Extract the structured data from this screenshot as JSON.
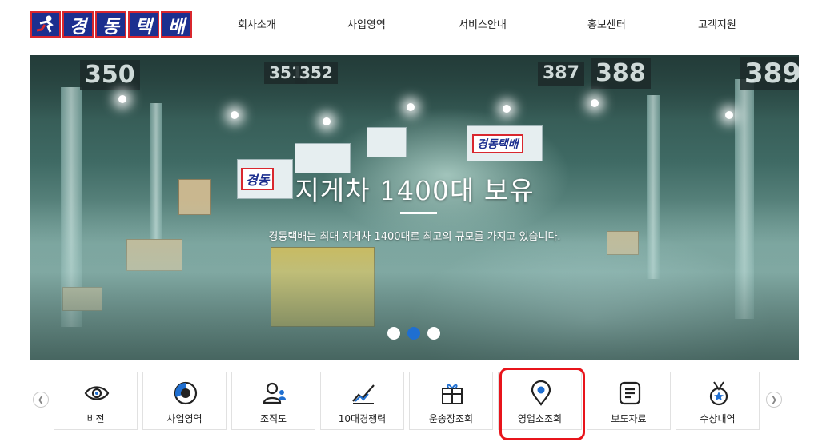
{
  "header": {
    "logo_text": [
      "경",
      "동",
      "택",
      "배"
    ],
    "nav": [
      "회사소개",
      "사업영역",
      "서비스안내",
      "홍보센터",
      "고객지원"
    ]
  },
  "hero": {
    "dock_signs": [
      "350",
      "351",
      "352",
      "387",
      "388",
      "389"
    ],
    "truck_logos": [
      "경동택배",
      "경동"
    ],
    "title": "지게차 1400대 보유",
    "subtitle": "경동택배는 최대 지게차 1400대로 최고의 규모를 가지고 있습니다.",
    "slides": 3,
    "active_slide": 2
  },
  "quick_menu": {
    "prev_icon": "chevron-left-icon",
    "next_icon": "chevron-right-icon",
    "items": [
      {
        "label": "비전",
        "icon": "eye-icon"
      },
      {
        "label": "사업영역",
        "icon": "pie-chart-icon"
      },
      {
        "label": "조직도",
        "icon": "people-icon"
      },
      {
        "label": "10대경쟁력",
        "icon": "trend-chart-icon"
      },
      {
        "label": "운송장조회",
        "icon": "gift-box-icon"
      },
      {
        "label": "영업소조회",
        "icon": "map-pin-icon"
      },
      {
        "label": "보도자료",
        "icon": "document-lines-icon"
      },
      {
        "label": "수상내역",
        "icon": "medal-icon"
      }
    ],
    "highlighted_item": "영업소조회"
  },
  "colors": {
    "brand_blue": "#1c2f8f",
    "brand_red": "#d9272e",
    "accent_blue": "#1f6fd1",
    "highlight_red": "#e8141b"
  }
}
